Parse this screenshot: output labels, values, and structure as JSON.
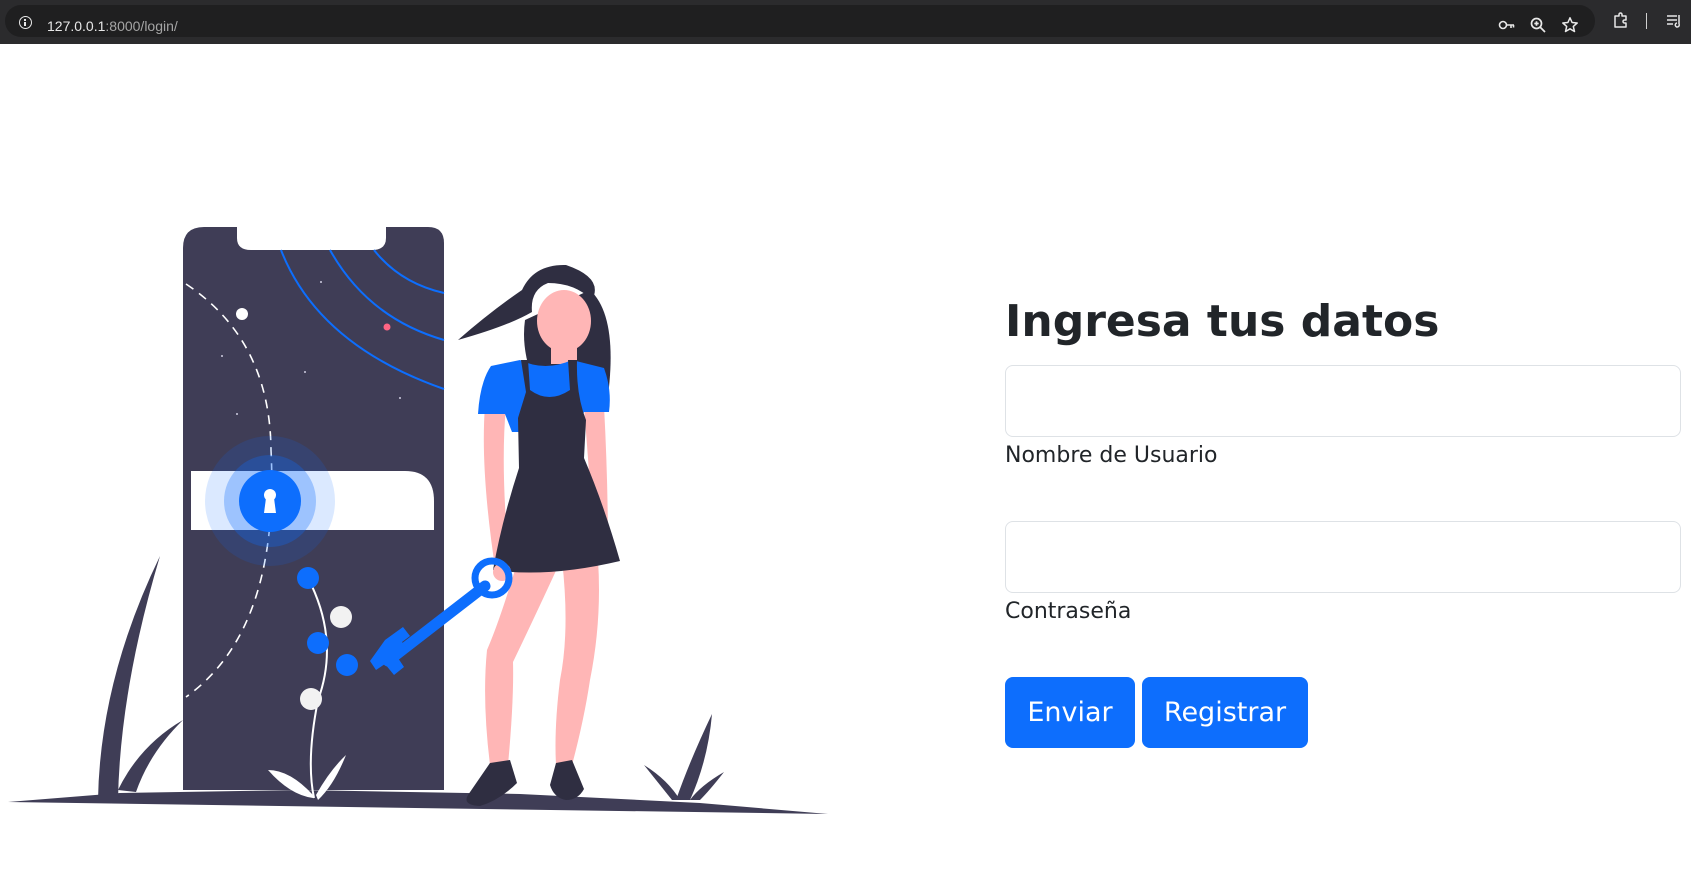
{
  "browser": {
    "url_host": "127.0.0.1",
    "url_path": ":8000/login/",
    "icons": [
      "info-icon",
      "key-icon",
      "zoom-icon",
      "star-icon",
      "extensions-icon",
      "reading-list-icon"
    ]
  },
  "form": {
    "title": "Ingresa tus datos",
    "username_label": "Nombre de Usuario",
    "username_value": "",
    "password_label": "Contraseña",
    "password_value": "",
    "submit_label": "Enviar",
    "register_label": "Registrar"
  },
  "colors": {
    "primary": "#0d6efd",
    "text": "#212529",
    "illustration_dark": "#3f3d56",
    "illustration_skin": "#ffb6b6",
    "chrome_bg": "#2b2b2d"
  }
}
